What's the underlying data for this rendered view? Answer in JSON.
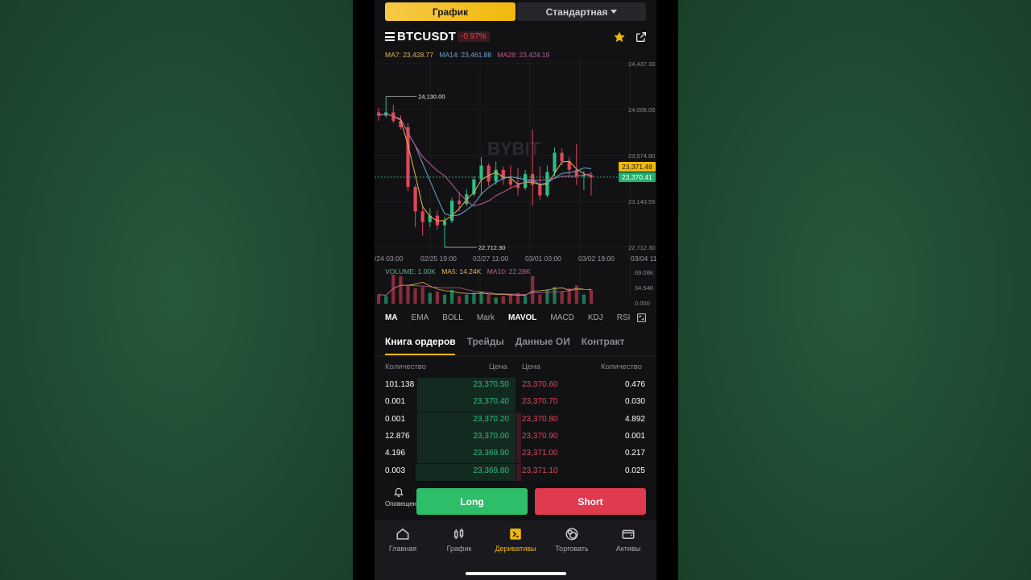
{
  "toggle": {
    "chart_label": "График",
    "type_label": "Стандартная"
  },
  "header": {
    "symbol": "BTCUSDT",
    "change": "-0.97%"
  },
  "ma": {
    "ma7": "MA7: 23,428.77",
    "ma14": "MA14: 23,461.88",
    "ma28": "MA28: 23,424.19"
  },
  "price_axis": [
    "24,437.30",
    "24,006.05",
    "23,574.80",
    "23,143.55",
    "22,712.30"
  ],
  "price_tags": {
    "last": "23,371.48",
    "mark": "23,370.41"
  },
  "annotations": {
    "high": "24,130.00",
    "low": "22,712.30"
  },
  "date_axis": [
    "/24 03:00",
    "02/25 19:00",
    "02/27 11:00",
    "03/01 03:00",
    "03/02 19:00",
    "03/04 11"
  ],
  "volume": {
    "vol": "VOLUME: 1.00K",
    "ma5": "MA5: 14.24K",
    "ma10": "MA10: 22.28K",
    "axis": [
      "69.08K",
      "34.54K",
      "0.000"
    ]
  },
  "watermark": "BYBIT",
  "indicators": [
    "MA",
    "EMA",
    "BOLL",
    "Mark",
    "MAVOL",
    "MACD",
    "KDJ",
    "RSI"
  ],
  "tabs": [
    "Книга ордеров",
    "Трейды",
    "Данные ОИ",
    "Контракт"
  ],
  "orderbook": {
    "headers": {
      "bid_qty": "Количество",
      "bid_price": "Цена",
      "ask_price": "Цена",
      "ask_qty": "Количество"
    },
    "rows": [
      {
        "bid_qty": "101.138",
        "bid_price": "23,370.50",
        "ask_price": "23,370.60",
        "ask_qty": "0.476",
        "bid_depth": 0.98,
        "ask_depth": 0.0
      },
      {
        "bid_qty": "0.001",
        "bid_price": "23,370.40",
        "ask_price": "23,370.70",
        "ask_qty": "0.030",
        "bid_depth": 0.98,
        "ask_depth": 0.0
      },
      {
        "bid_qty": "0.001",
        "bid_price": "23,370.20",
        "ask_price": "23,370.80",
        "ask_qty": "4.892",
        "bid_depth": 0.98,
        "ask_depth": 0.04
      },
      {
        "bid_qty": "12.876",
        "bid_price": "23,370.00",
        "ask_price": "23,370.90",
        "ask_qty": "0.001",
        "bid_depth": 0.98,
        "ask_depth": 0.04
      },
      {
        "bid_qty": "4.196",
        "bid_price": "23,369.90",
        "ask_price": "23,371.00",
        "ask_qty": "0.217",
        "bid_depth": 0.98,
        "ask_depth": 0.04
      },
      {
        "bid_qty": "0.003",
        "bid_price": "23,369.80",
        "ask_price": "23,371.10",
        "ask_qty": "0.025",
        "bid_depth": 1.0,
        "ask_depth": 0.04
      }
    ]
  },
  "actions": {
    "alerts": "Оповещения",
    "long": "Long",
    "short": "Short"
  },
  "nav": [
    {
      "label": "Главная",
      "icon": "home-icon"
    },
    {
      "label": "График",
      "icon": "candles-icon"
    },
    {
      "label": "Деривативы",
      "icon": "derivatives-icon"
    },
    {
      "label": "Торговать",
      "icon": "trade-icon"
    },
    {
      "label": "Активы",
      "icon": "wallet-icon"
    }
  ],
  "colors": {
    "accent": "#f0b90b",
    "up": "#2ebd85",
    "down": "#e0465a",
    "long": "#2ebd69",
    "short": "#e03a4e"
  }
}
